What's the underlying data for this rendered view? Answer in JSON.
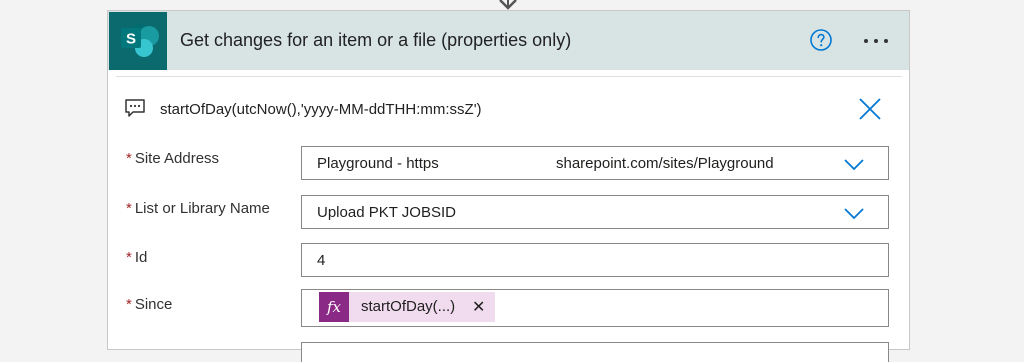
{
  "card": {
    "title": "Get changes for an item or a file (properties only)",
    "app_icon": "sharepoint-icon",
    "help_icon": "help-circle-icon",
    "more_icon": "ellipsis-icon"
  },
  "expression": {
    "text": "startOfDay(utcNow(),'yyyy-MM-ddTHH:mm:ssZ')",
    "icon": "comment-icon",
    "close_icon": "close-icon"
  },
  "fields": {
    "site_address": {
      "required_mark": "*",
      "label": "Site Address",
      "value_left": "Playground - https",
      "value_right": "sharepoint.com/sites/Playground"
    },
    "list_name": {
      "required_mark": "*",
      "label": "List or Library Name",
      "value": "Upload PKT JOBSID"
    },
    "id": {
      "required_mark": "*",
      "label": "Id",
      "value": "4"
    },
    "since": {
      "required_mark": "*",
      "label": "Since",
      "token": {
        "icon_text": "fx",
        "label": "startOfDay(...)",
        "remove": "✕"
      }
    }
  },
  "colors": {
    "header_bg": "#d8e4e4",
    "sharepoint_tile": "#0b6a6e",
    "accent_blue": "#0078d4",
    "required_red": "#a4262c",
    "token_bg": "#f0dcee",
    "token_icon_bg": "#8b2a86"
  }
}
